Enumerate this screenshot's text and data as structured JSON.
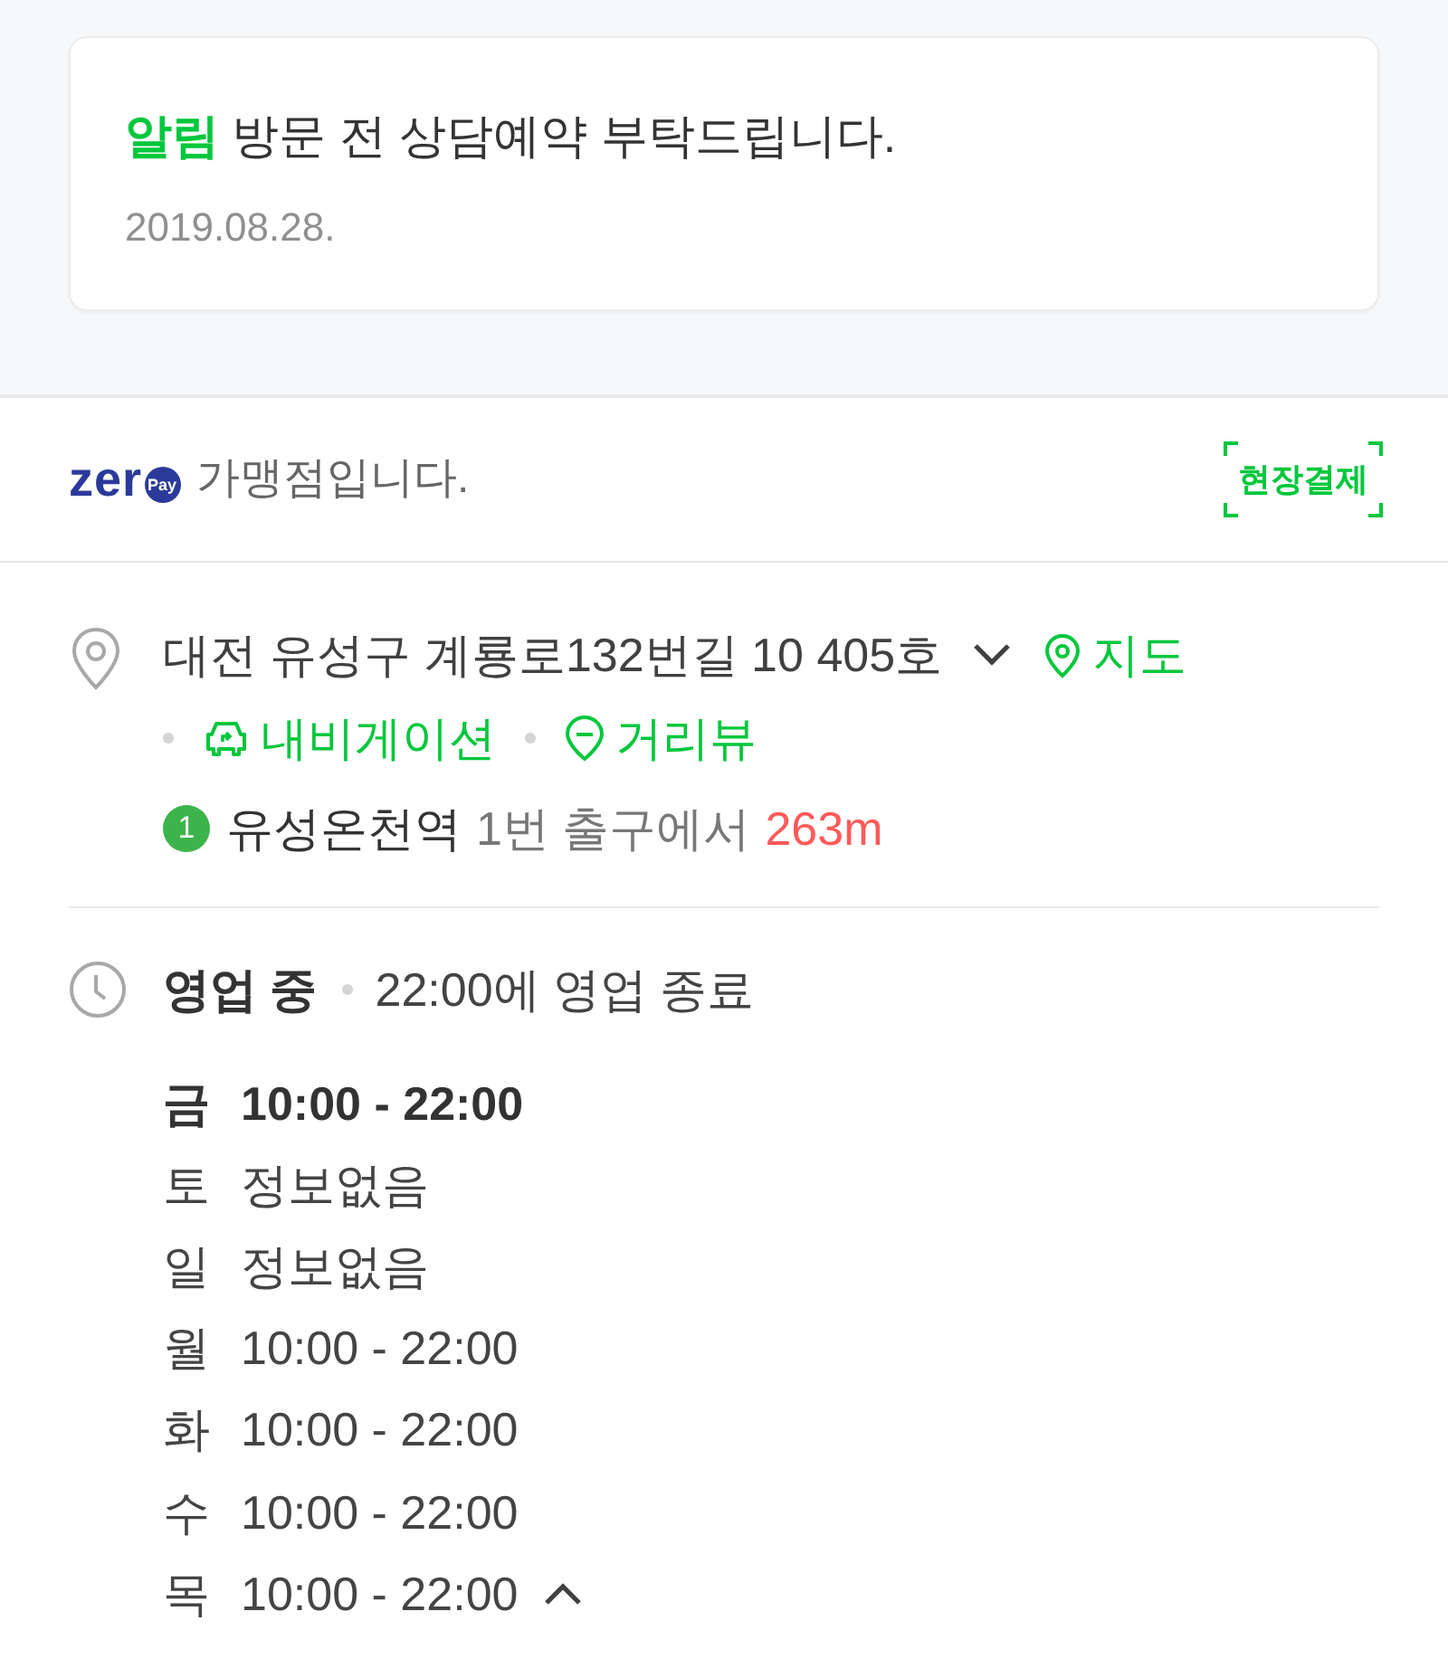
{
  "notice": {
    "label": "알림",
    "message": "방문 전 상담예약 부탁드립니다.",
    "date": "2019.08.28."
  },
  "payment": {
    "logo_word": "zer",
    "logo_badge": "Pay",
    "text": "가맹점입니다.",
    "badge": "현장결제"
  },
  "address": {
    "text": "대전 유성구 계룡로132번길 10 405호",
    "expanded": false,
    "map_link": "지도",
    "links": [
      {
        "kind": "navigation",
        "label": "내비게이션"
      },
      {
        "kind": "street_view",
        "label": "거리뷰"
      }
    ],
    "transit": {
      "line": "1",
      "color": "#3cb44b",
      "station": "유성온천역",
      "exit": "1번 출구에서",
      "distance": "263m"
    }
  },
  "hours": {
    "status": "영업 중",
    "note": "22:00에 영업 종료",
    "expanded": true,
    "days": [
      {
        "day": "금",
        "time": "10:00 - 22:00",
        "today": true
      },
      {
        "day": "토",
        "time": "정보없음",
        "today": false
      },
      {
        "day": "일",
        "time": "정보없음",
        "today": false
      },
      {
        "day": "월",
        "time": "10:00 - 22:00",
        "today": false
      },
      {
        "day": "화",
        "time": "10:00 - 22:00",
        "today": false
      },
      {
        "day": "수",
        "time": "10:00 - 22:00",
        "today": false
      },
      {
        "day": "목",
        "time": "10:00 - 22:00",
        "today": false
      }
    ]
  }
}
